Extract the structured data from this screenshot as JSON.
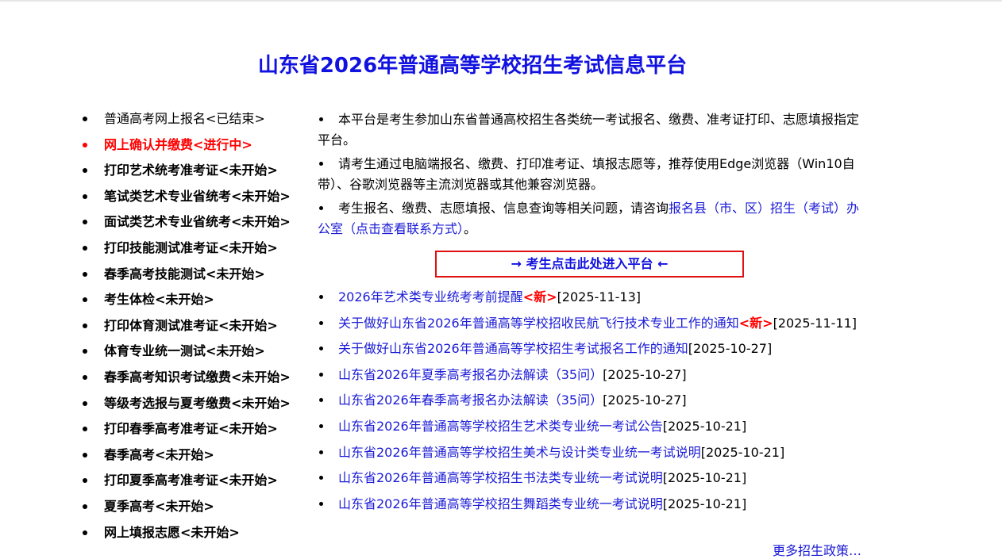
{
  "header": {
    "title": "山东省2026年普通高等学校招生考试信息平台"
  },
  "sidebar": {
    "items": [
      {
        "label": "普通高考网上报名<已结束>",
        "state": "done"
      },
      {
        "label": "网上确认并缴费<进行中>",
        "state": "active"
      },
      {
        "label": "打印艺术统考准考证<未开始>",
        "state": "pending"
      },
      {
        "label": "笔试类艺术专业省统考<未开始>",
        "state": "pending"
      },
      {
        "label": "面试类艺术专业省统考<未开始>",
        "state": "pending"
      },
      {
        "label": "打印技能测试准考证<未开始>",
        "state": "pending"
      },
      {
        "label": "春季高考技能测试<未开始>",
        "state": "pending"
      },
      {
        "label": "考生体检<未开始>",
        "state": "pending"
      },
      {
        "label": "打印体育测试准考证<未开始>",
        "state": "pending"
      },
      {
        "label": "体育专业统一测试<未开始>",
        "state": "pending"
      },
      {
        "label": "春季高考知识考试缴费<未开始>",
        "state": "pending"
      },
      {
        "label": "等级考选报与夏考缴费<未开始>",
        "state": "pending"
      },
      {
        "label": "打印春季高考准考证<未开始>",
        "state": "pending"
      },
      {
        "label": "春季高考<未开始>",
        "state": "pending"
      },
      {
        "label": "打印夏季高考准考证<未开始>",
        "state": "pending"
      },
      {
        "label": "夏季高考<未开始>",
        "state": "pending"
      },
      {
        "label": "网上填报志愿<未开始>",
        "state": "pending"
      }
    ]
  },
  "info": {
    "p1": "本平台是考生参加山东省普通高校招生各类统一考试报名、缴费、准考证打印、志愿填报指定平台。",
    "p2": "请考生通过电脑端报名、缴费、打印准考证、填报志愿等，推荐使用Edge浏览器（Win10自带）、谷歌浏览器等主流浏览器或其他兼容浏览器。",
    "p3_prefix": "考生报名、缴费、志愿填报、信息查询等相关问题，请咨询",
    "p3_link": "报名县（市、区）招生（考试）办公室（点击查看联系方式）",
    "p3_suffix": "。"
  },
  "enter_button": {
    "label": "→ 考生点击此处进入平台 ←"
  },
  "news": {
    "items": [
      {
        "title": "2026年艺术类专业统考考前提醒",
        "new_tag": "<新>",
        "date": "[2025-11-13]"
      },
      {
        "title": "关于做好山东省2026年普通高等学校招收民航飞行技术专业工作的通知",
        "new_tag": "<新>",
        "date": "[2025-11-11]"
      },
      {
        "title": "关于做好山东省2026年普通高等学校招生考试报名工作的通知",
        "new_tag": "",
        "date": "[2025-10-27]"
      },
      {
        "title": "山东省2026年夏季高考报名办法解读（35问）",
        "new_tag": "",
        "date": "[2025-10-27]"
      },
      {
        "title": "山东省2026年春季高考报名办法解读（35问）",
        "new_tag": "",
        "date": "[2025-10-27]"
      },
      {
        "title": "山东省2026年普通高等学校招生艺术类专业统一考试公告",
        "new_tag": "",
        "date": "[2025-10-21]"
      },
      {
        "title": "山东省2026年普通高等学校招生美术与设计类专业统一考试说明",
        "new_tag": "",
        "date": "[2025-10-21]"
      },
      {
        "title": "山东省2026年普通高等学校招生书法类专业统一考试说明",
        "new_tag": "",
        "date": "[2025-10-21]"
      },
      {
        "title": "山东省2026年普通高等学校招生舞蹈类专业统一考试说明",
        "new_tag": "",
        "date": "[2025-10-21]"
      }
    ],
    "more_label": "更多招生政策…"
  }
}
